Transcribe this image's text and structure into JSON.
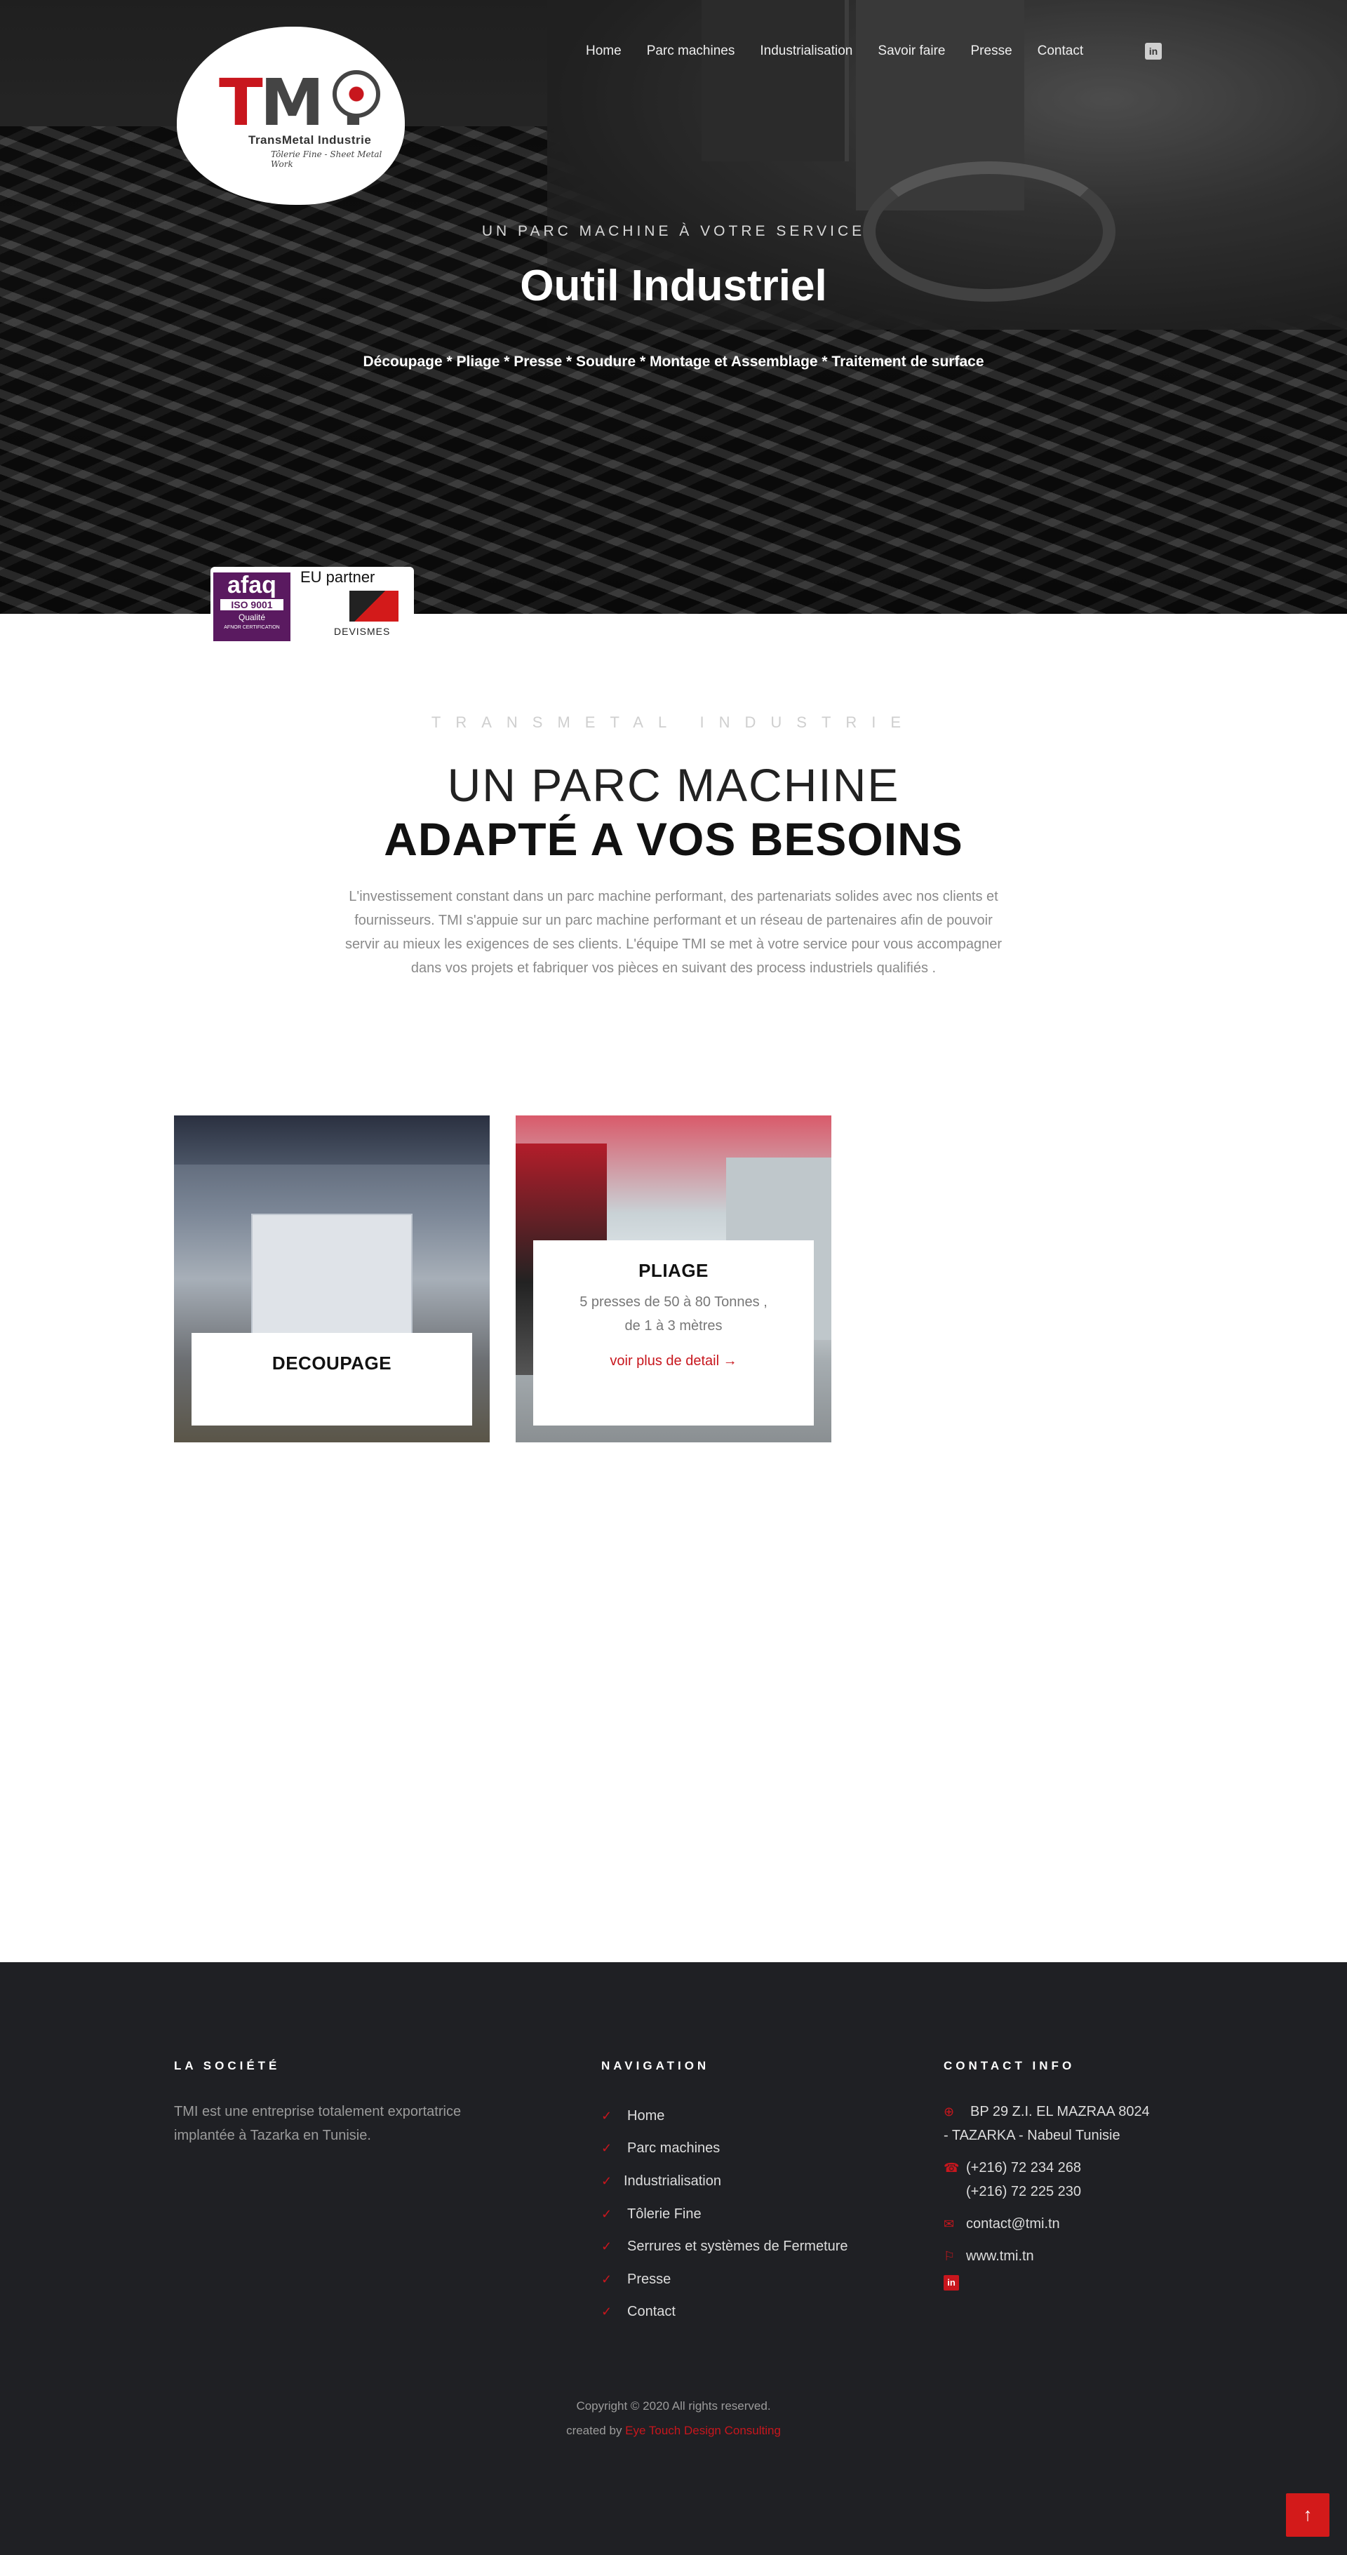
{
  "nav": {
    "items": [
      "Home",
      "Parc machines",
      "Industrialisation",
      "Savoir faire",
      "Presse",
      "Contact"
    ],
    "linkedin_icon": "linkedin-icon"
  },
  "logo": {
    "mark": "TMI",
    "name": "TransMetal Industrie",
    "tagline": "Tôlerie Fine - Sheet Metal Work"
  },
  "hero": {
    "subtitle": "UN PARC MACHINE À VOTRE SERVICE",
    "title": "Outil Industriel",
    "services": "Découpage * Pliage * Presse * Soudure * Montage et Assemblage * Traitement de surface"
  },
  "badges": {
    "afaq": "afaq",
    "iso": "ISO 9001",
    "quality": "Qualité",
    "cert": "AFNOR CERTIFICATION",
    "eu_partner": "EU partner",
    "devismes": "DEVISMES"
  },
  "intro": {
    "kicker": "TRANSMETAL INDUSTRIE",
    "title_light": "UN PARC MACHINE",
    "title_bold": "ADAPTÉ A VOS BESOINS",
    "text": "L'investissement constant dans un parc machine performant, des partenariats solides avec nos clients et fournisseurs. TMI s'appuie sur un parc machine performant et un réseau de partenaires afin de pouvoir servir au mieux les exigences de ses clients. L'équipe TMI se met à votre service pour vous accompagner dans vos projets et fabriquer vos pièces en suivant des process industriels qualifiés ."
  },
  "cards": [
    {
      "title": "DECOUPAGE"
    },
    {
      "title": "PLIAGE",
      "desc_line1": "5 presses de 50 à 80 Tonnes ,",
      "desc_line2": "de 1 à 3 mètres",
      "link": "voir plus de detail →"
    }
  ],
  "footer": {
    "about_heading": "LA SOCIÉTÉ",
    "about_text": "TMI est une entreprise totalement exportatrice implantée à Tazarka en Tunisie.",
    "nav_heading": "NAVIGATION",
    "nav_items": [
      "Home",
      "Parc machines",
      "Industrialisation",
      "Tôlerie Fine",
      "Serrures et systèmes de Fermeture",
      "Presse",
      "Contact"
    ],
    "contact_heading": "CONTACT INFO",
    "address": "BP 29 Z.I. EL MAZRAA 8024 - TAZARKA - Nabeul Tunisie",
    "phone1": "(+216) 72 234 268",
    "phone2": "(+216) 72 225 230",
    "email": "contact@tmi.tn",
    "website": "www.tmi.tn",
    "copyright": "Copyright © 2020 All rights reserved.",
    "created_by": "created by ",
    "agency": "Eye Touch Design Consulting"
  },
  "colors": {
    "accent": "#c8161d",
    "footer_bg": "#1f2024"
  }
}
